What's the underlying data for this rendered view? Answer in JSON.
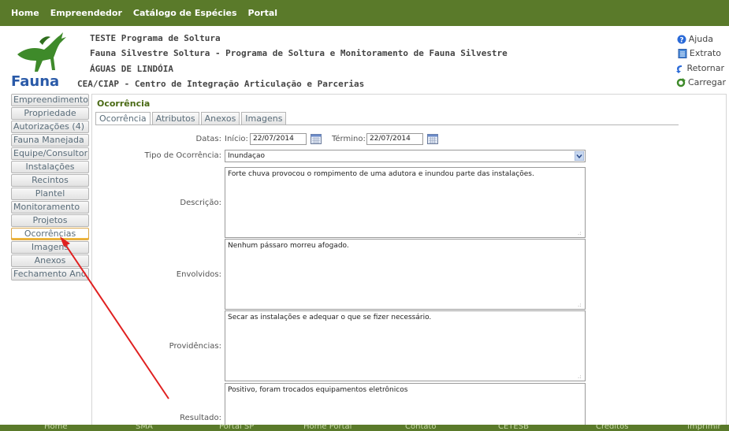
{
  "topnav": {
    "items": [
      "Home",
      "Empreendedor",
      "Catálogo de Espécies",
      "Portal"
    ]
  },
  "header": {
    "logo_text": "Fauna",
    "line1": "TESTE Programa de Soltura",
    "line2": "Fauna Silvestre Soltura - Programa de Soltura e Monitoramento de Fauna Silvestre",
    "line3": "ÁGUAS DE LINDÓIA",
    "line4": "CEA/CIAP - Centro de Integração Articulação e Parcerias"
  },
  "utility": {
    "ajuda": "Ajuda",
    "extrato": "Extrato",
    "retornar": "Retornar",
    "carregar": "Carregar"
  },
  "sidebar": {
    "items": [
      "Empreendimento",
      "Propriedade",
      "Autorizações (4)",
      "Fauna Manejada",
      "Equipe/Consultor",
      "Instalações",
      "Recintos",
      "Plantel",
      "Monitoramento",
      "Projetos",
      "Ocorrências",
      "Imagens",
      "Anexos",
      "Fechamento Ano"
    ],
    "active": "Ocorrências"
  },
  "main": {
    "section_title": "Ocorrência",
    "tabs": [
      "Ocorrência",
      "Atributos",
      "Anexos",
      "Imagens"
    ],
    "active_tab": "Ocorrência",
    "datas_label": "Datas:",
    "inicio_label": "Início:",
    "inicio_value": "22/07/2014",
    "termino_label": "Término:",
    "termino_value": "22/07/2014",
    "tipo_label": "Tipo de Ocorrência:",
    "tipo_value": "Inundaçao",
    "descricao_label": "Descrição:",
    "descricao_value": "Forte chuva provocou o rompimento de uma adutora e inundou parte das instalações.",
    "envolvidos_label": "Envolvidos:",
    "envolvidos_value": "Nenhum pássaro morreu afogado.",
    "providencias_label": "Providências:",
    "providencias_value": "Secar as instalações e adequar o que se fizer necessário.",
    "resultado_label": "Resultado:",
    "resultado_value": "Positivo, foram trocados equipamentos eletrônicos"
  },
  "footer": {
    "items": [
      "Home",
      "SMA",
      "Portal SP",
      "Home Portal",
      "Contato",
      "CETESB",
      "Créditos",
      "Imprimir"
    ]
  },
  "colors": {
    "nav_green": "#5a7a2a",
    "title_green": "#4a6a15",
    "annotation_red": "#e02020"
  }
}
